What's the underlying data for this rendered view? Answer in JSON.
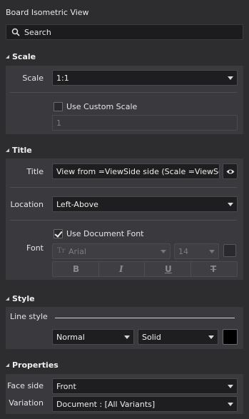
{
  "panel": {
    "title": "Board Isometric View"
  },
  "search": {
    "placeholder": "Search",
    "icon": "search-icon"
  },
  "sections": {
    "scale": {
      "title": "Scale",
      "scale_label": "Scale",
      "scale_value": "1:1",
      "custom_scale_label": "Use Custom Scale",
      "custom_scale_checked": false,
      "custom_scale_value": "1"
    },
    "title": {
      "title": "Title",
      "title_label": "Title",
      "title_value": "View from =ViewSide side (Scale =ViewScale",
      "location_label": "Location",
      "location_value": "Left-Above",
      "font_label": "Font",
      "use_document_font_label": "Use Document Font",
      "use_document_font_checked": true,
      "font_family": "Arial",
      "font_size": "14",
      "format_buttons": [
        "B",
        "I",
        "U",
        "T"
      ]
    },
    "style": {
      "title": "Style",
      "line_style_label": "Line style",
      "line_weight_value": "Normal",
      "line_pattern_value": "Solid",
      "color": "#000000"
    },
    "properties": {
      "title": "Properties",
      "face_side_label": "Face side",
      "face_side_value": "Front",
      "variation_label": "Variation",
      "variation_value": "Document : [All Variants]"
    }
  },
  "colors": {
    "background": "#2d2d30",
    "section_bg": "#3a3a3e",
    "input_bg": "#1e1e20"
  }
}
